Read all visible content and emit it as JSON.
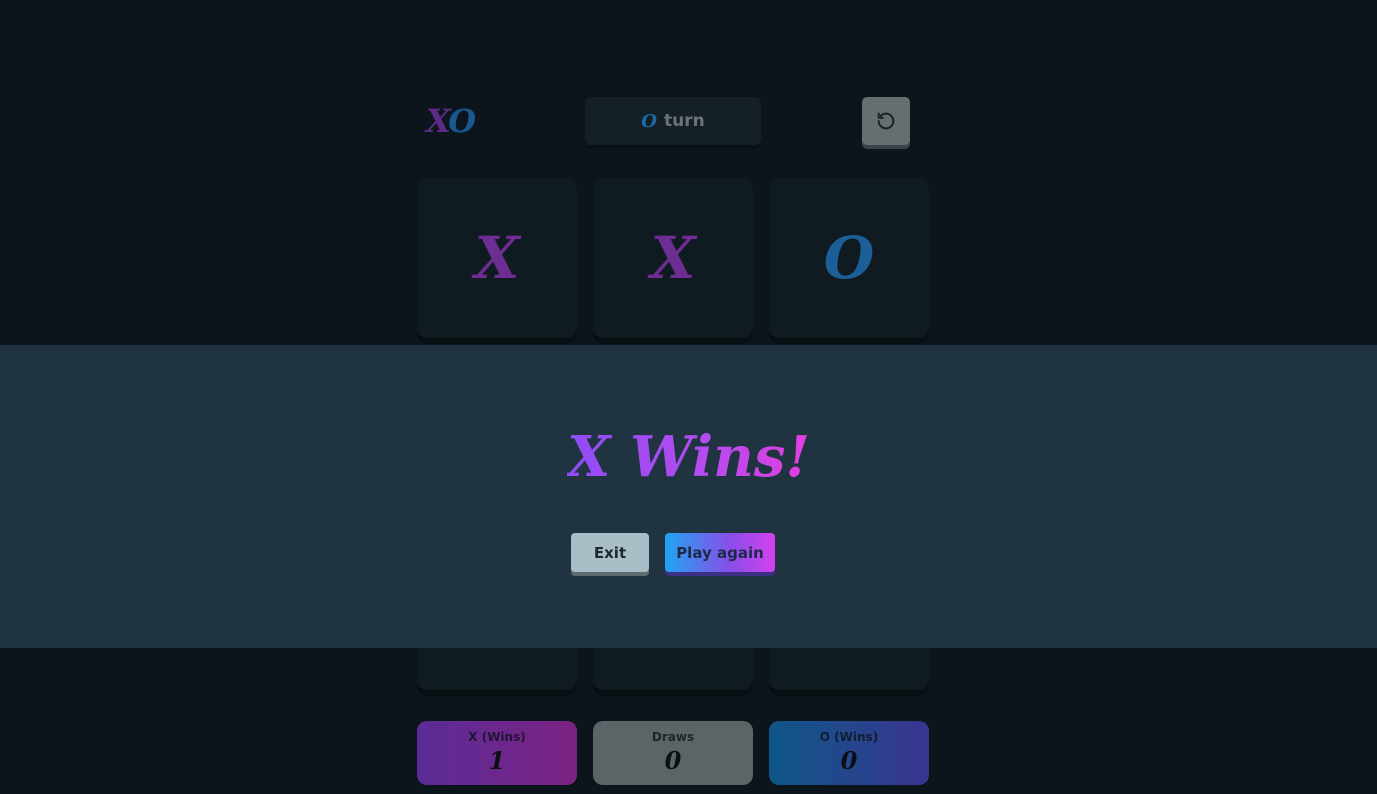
{
  "header": {
    "logo_x": "X",
    "logo_o": "O",
    "turn_mark": "O",
    "turn_label": "turn",
    "restart_icon": "restart-icon"
  },
  "board": {
    "cells": [
      "X",
      "X",
      "O",
      "",
      "",
      "",
      "",
      "",
      ""
    ]
  },
  "result_modal": {
    "title": "X Wins!",
    "exit_label": "Exit",
    "play_again_label": "Play again"
  },
  "score": {
    "x_label": "X (Wins)",
    "x_value": "1",
    "draws_label": "Draws",
    "draws_value": "0",
    "o_label": "O (Wins)",
    "o_value": "0"
  },
  "colors": {
    "background": "#0d151c",
    "x_accent": "#a03de0",
    "o_accent": "#2291f0",
    "modal_background": "#1f3440"
  }
}
